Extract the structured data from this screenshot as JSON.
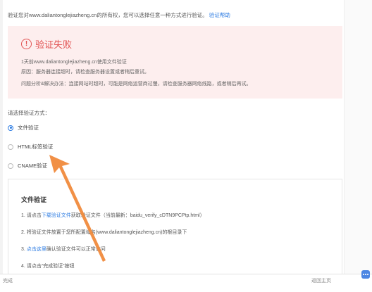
{
  "intro": {
    "text": "验证您对www.daliantonglejiazheng.cn的所有权，您可以选择任意一种方式进行验证。",
    "help_link": "验证帮助"
  },
  "error": {
    "title": "验证失败",
    "line1": "1天前www.daliantonglejiazheng.cn使用文件验证",
    "line2": "原因：服务器连接超时，请检查服务器设置或者稍后重试。",
    "line3": "问题分析&解决办法：连接网站时超时，可能是网络运营商过慢，请检查服务器网络线路，或者稍后再试。"
  },
  "method": {
    "label": "请选择验证方式：",
    "options": [
      {
        "label": "文件验证",
        "checked": true
      },
      {
        "label": "HTML标签验证",
        "checked": false
      },
      {
        "label": "CNAME验证",
        "checked": false
      }
    ]
  },
  "file_verify": {
    "title": "文件验证",
    "step1_pre": "1. 请点击",
    "step1_link": "下载验证文件",
    "step1_post": "获取验证文件（当前最新：baidu_verify_cDTN9PCPtp.html）",
    "step2": "2. 将验证文件放置于您所配置域名(www.daliantonglejiazheng.cn)的根目录下",
    "step3_pre": "3. ",
    "step3_link": "点击这里",
    "step3_post": "确认验证文件可以正常访问",
    "step4": "4. 请点击“完成验证”按钮"
  },
  "bottom": {
    "left_text": "完成",
    "right_text": "返回主页"
  },
  "colors": {
    "accent": "#2a7ae2",
    "error": "#e25454",
    "arrow": "#f08a3c"
  }
}
